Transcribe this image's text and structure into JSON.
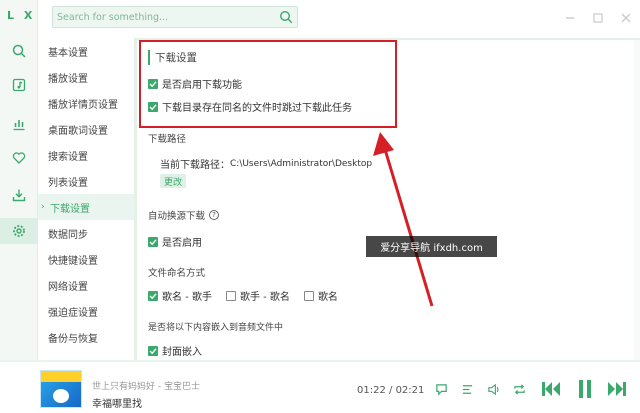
{
  "app": {
    "logo": "L X"
  },
  "search": {
    "placeholder": "Search for something..."
  },
  "settings_menu": {
    "items": [
      "基本设置",
      "播放设置",
      "播放详情页设置",
      "桌面歌词设置",
      "搜索设置",
      "列表设置",
      "下载设置",
      "数据同步",
      "快捷键设置",
      "网络设置",
      "强迫症设置",
      "备份与恢复"
    ],
    "active_index": 6
  },
  "download_section": {
    "title": "下载设置",
    "enable_download_label": "是否启用下载功能",
    "skip_same_name_label": "下载目录存在同名的文件时跳过下载此任务"
  },
  "download_path": {
    "title": "下载路径",
    "current_label": "当前下载路径：",
    "current_value": "C:\\Users\\Administrator\\Desktop",
    "change_button": "更改"
  },
  "auto_quality": {
    "title": "自动换源下载",
    "help_icon": "?",
    "enable_label": "是否启用"
  },
  "file_naming": {
    "title": "文件命名方式",
    "options": [
      "歌名 - 歌手",
      "歌手 - 歌名",
      "歌名"
    ],
    "selected_index": 0
  },
  "embed": {
    "title": "是否将以下内容嵌入到音频文件中",
    "cover_label": "封面嵌入"
  },
  "watermark": {
    "text": "爱分享导航 ifxdh.com"
  },
  "player": {
    "song_title": "世上只有妈妈好 - 宝宝巴士",
    "song_name": "幸福哪里找",
    "current_time": "01:22",
    "total_time": "02:21",
    "time_separator": " / "
  },
  "colors": {
    "accent": "#3ba86c",
    "highlight_box": "#d51f26"
  }
}
